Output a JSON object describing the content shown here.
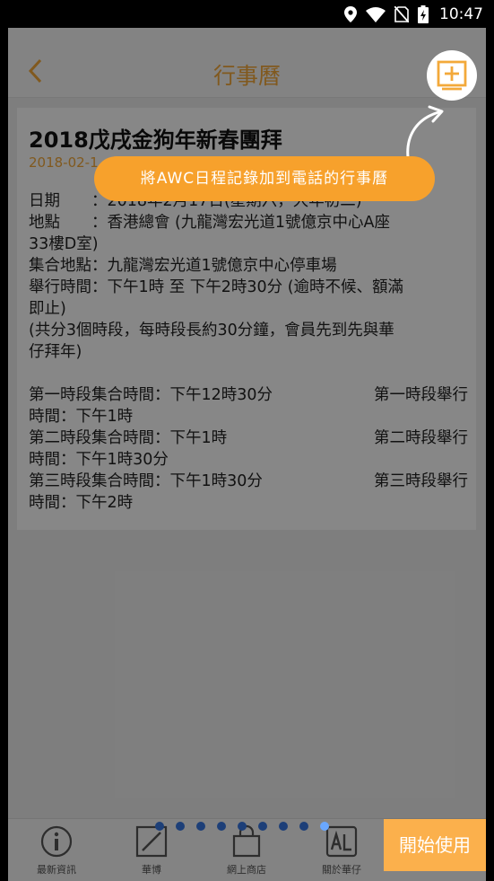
{
  "status_bar": {
    "time": "10:47",
    "icons": [
      "location-icon",
      "wifi-icon",
      "no-sim-icon",
      "battery-charging-icon"
    ]
  },
  "app_bar": {
    "title": "行事曆",
    "back_icon": "chevron-left-icon",
    "add_calendar_icon": "add-calendar-icon"
  },
  "event": {
    "title": "2018戊戌金狗年新春團拜",
    "date": "2018-02-1",
    "details": [
      "日期　　：2018年2月17日(星期六，大年初二)",
      "地點　　：香港總會 (九龍灣宏光道1號億京中心A座",
      "33樓D室)",
      "集合地點：九龍灣宏光道1號億京中心停車場",
      "舉行時間：下午1時 至 下午2時30分 (逾時不候、額滿",
      "即止)",
      "(共分3個時段，每時段長約30分鐘，會員先到先與華",
      "仔拜年)"
    ],
    "sessions": [
      {
        "assembly": "第一時段集合時間：下午12時30分",
        "held_label": "第一時段舉行",
        "held": "時間：下午1時"
      },
      {
        "assembly": "第二時段集合時間：下午1時",
        "held_label": "第二時段舉行",
        "held": "時間：下午1時30分"
      },
      {
        "assembly": "第三時段集合時間：下午1時30分",
        "held_label": "第三時段舉行",
        "held": "時間：下午2時"
      }
    ]
  },
  "onboarding": {
    "hint": "將AWC日程記錄加到電話的行事曆",
    "start_button": "開始使用",
    "page_count": 9,
    "active_page": 9
  },
  "tab_bar": {
    "items": [
      {
        "label": "最新資訊",
        "icon": "info-icon"
      },
      {
        "label": "華博",
        "icon": "pen-icon"
      },
      {
        "label": "網上商店",
        "icon": "shopping-bag-icon"
      },
      {
        "label": "關於華仔",
        "icon": "al-logo-icon"
      }
    ]
  },
  "colors": {
    "accent": "#f3a93a",
    "hint_bg": "#f7a12c",
    "start_bg": "#fbb04c",
    "dot": "#1d3f78",
    "dot_active": "#6aa8ff"
  }
}
